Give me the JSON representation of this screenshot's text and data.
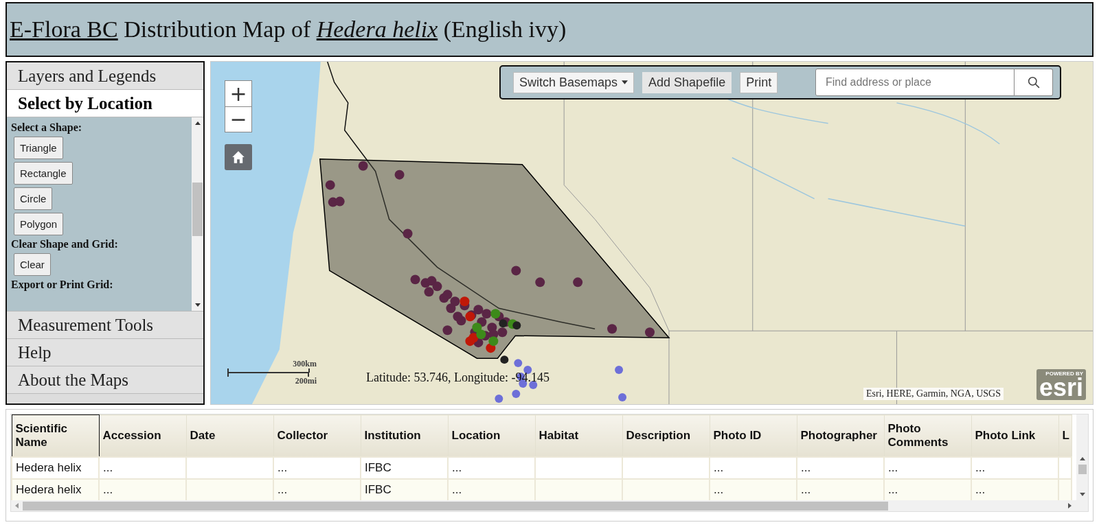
{
  "title": {
    "link": "E-Flora BC",
    "text": "Distribution Map of",
    "species": "Hedera helix",
    "common": "(English ivy)"
  },
  "sidebar": {
    "items": [
      {
        "label": "Layers and Legends",
        "selected": false
      },
      {
        "label": "Select by Location",
        "selected": true
      },
      {
        "label": "Measurement Tools",
        "selected": false
      },
      {
        "label": "Help",
        "selected": false
      },
      {
        "label": "About the Maps",
        "selected": false
      }
    ],
    "sections": [
      {
        "heading": "Select a Shape:",
        "buttons": [
          "Triangle",
          "Rectangle",
          "Circle",
          "Polygon"
        ]
      },
      {
        "heading": "Clear Shape and Grid:",
        "buttons": [
          "Clear"
        ]
      },
      {
        "heading": "Export or Print Grid:"
      }
    ]
  },
  "map": {
    "toolbar": {
      "basemaps": "Switch Basemaps",
      "shapefile": "Add Shapefile",
      "print": "Print",
      "search": {
        "placeholder": "Find address or place"
      }
    },
    "zoom_in": "+",
    "zoom_out": "−",
    "scale": {
      "metric": "300km",
      "imperial": "200mi"
    },
    "coordinates": "Latitude: 53.746, Longitude: -94.145",
    "attribution": "Esri, HERE, Garmin, NGA, USGS",
    "logo": {
      "powered_by": "POWERED BY",
      "name": "esri"
    }
  },
  "table": {
    "columns": [
      "Scientific Name",
      "Accession",
      "Date",
      "Collector",
      "Institution",
      "Location",
      "Habitat",
      "Description",
      "Photo ID",
      "Photographer",
      "Photo Comments",
      "Photo Link",
      "L"
    ],
    "rows": [
      [
        "Hedera helix",
        "...",
        "",
        "...",
        "IFBC",
        "...",
        "",
        "",
        "...",
        "...",
        "...",
        "...",
        ""
      ],
      [
        "Hedera helix",
        "...",
        "",
        "...",
        "IFBC",
        "...",
        "",
        "",
        "...",
        "...",
        "...",
        "...",
        ""
      ]
    ]
  }
}
